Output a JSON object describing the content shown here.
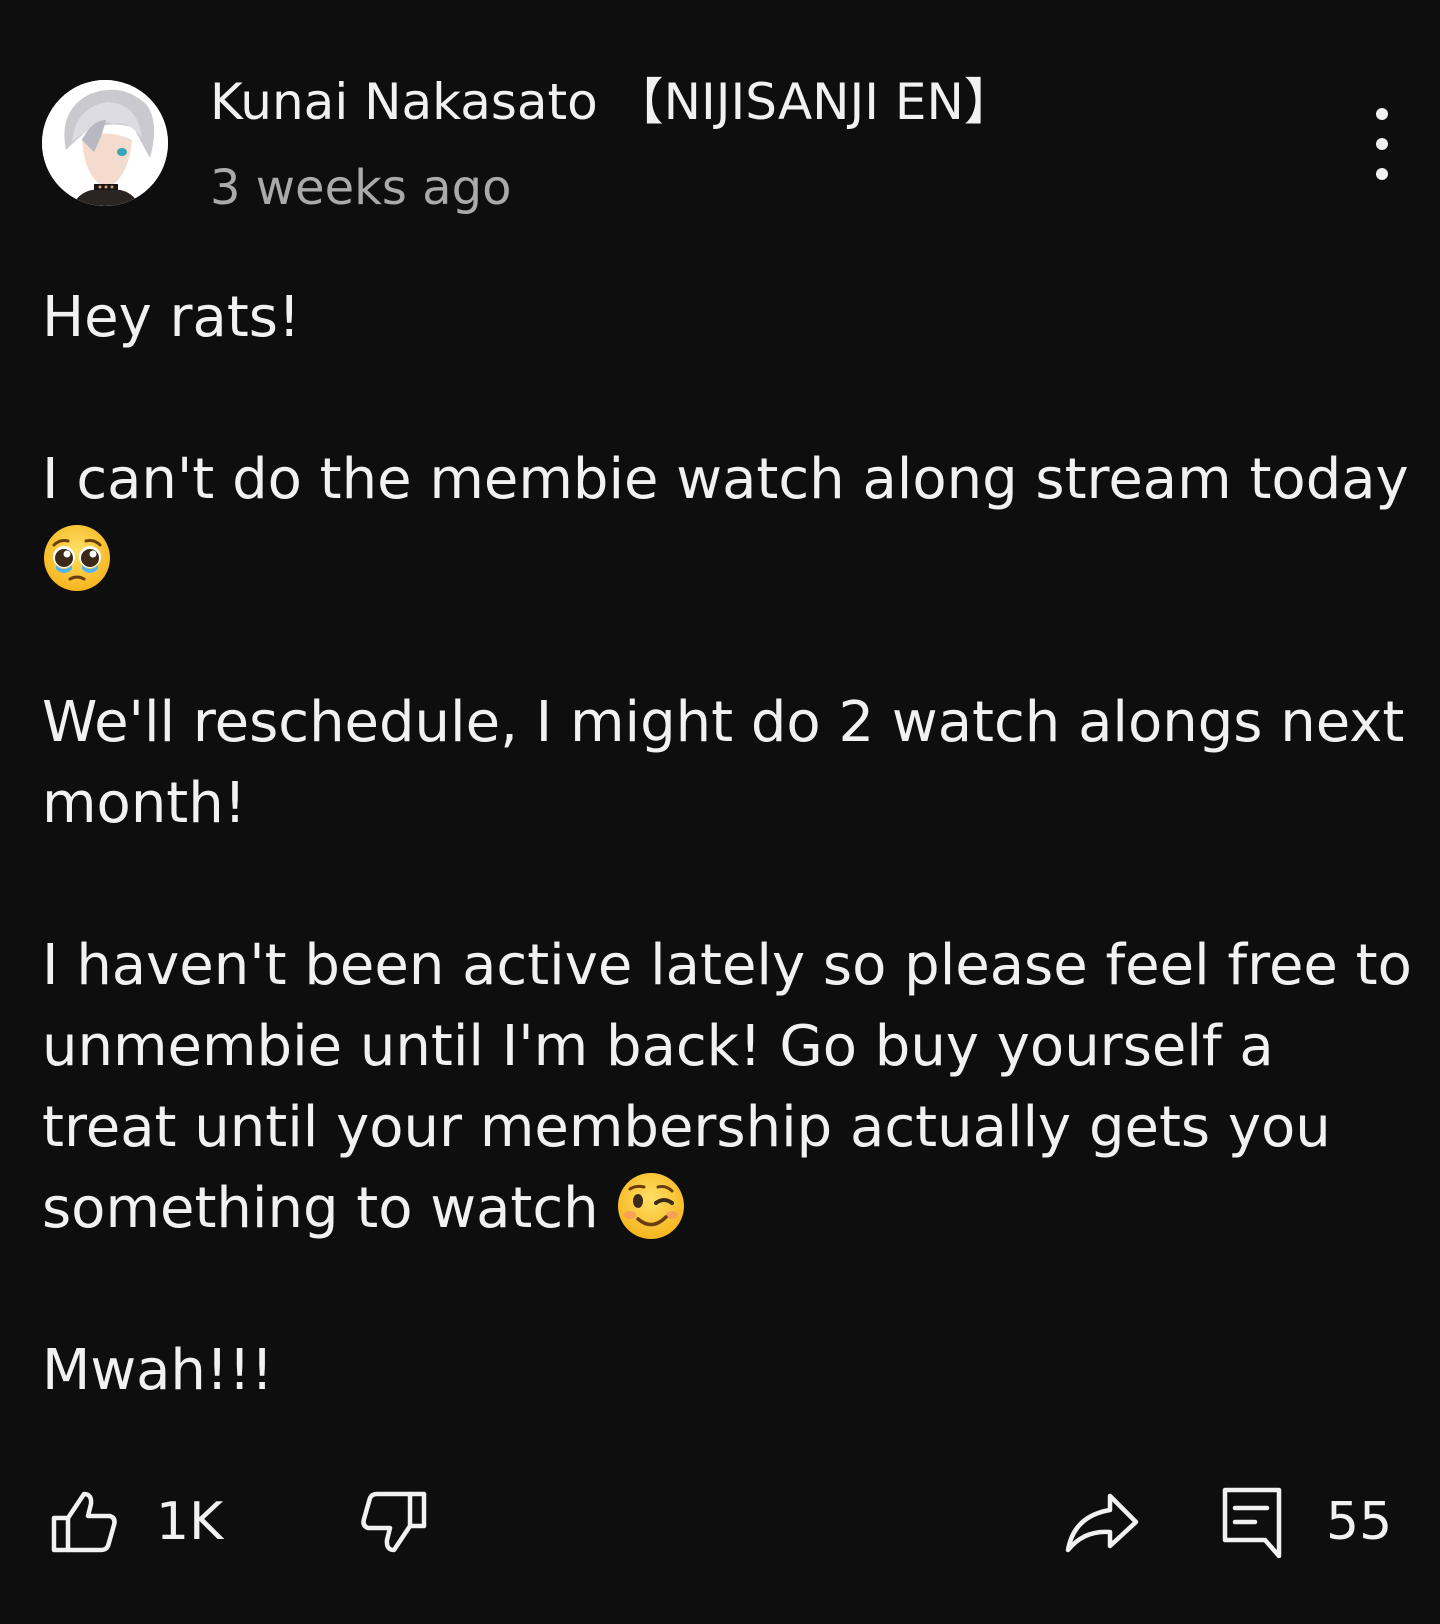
{
  "post": {
    "author_name": "Kunai Nakasato 【NIJISANJI EN】",
    "timestamp": "3 weeks ago",
    "avatar_icon": "avatar-image",
    "menu_icon": "more-vertical-icon",
    "paragraphs": [
      "Hey rats!",
      "I can't do the membie watch along stream today",
      "We'll reschedule, I might do 2 watch alongs next month!",
      "I haven't been active lately so please feel free to unmembie until I'm back! Go buy yourself a treat until your membership actually gets you something to watch",
      "Mwah!!!"
    ],
    "emojis": {
      "pleading_face": "pleading-face-emoji",
      "winking_face": "winking-face-emoji"
    }
  },
  "actions": {
    "like_icon": "thumbs-up-icon",
    "like_count": "1K",
    "dislike_icon": "thumbs-down-icon",
    "share_icon": "share-icon",
    "comment_icon": "comment-icon",
    "comment_count": "55"
  },
  "colors": {
    "background": "#0e0e0f",
    "text_primary": "#f1f1f1",
    "text_secondary": "#aaaaaa"
  }
}
